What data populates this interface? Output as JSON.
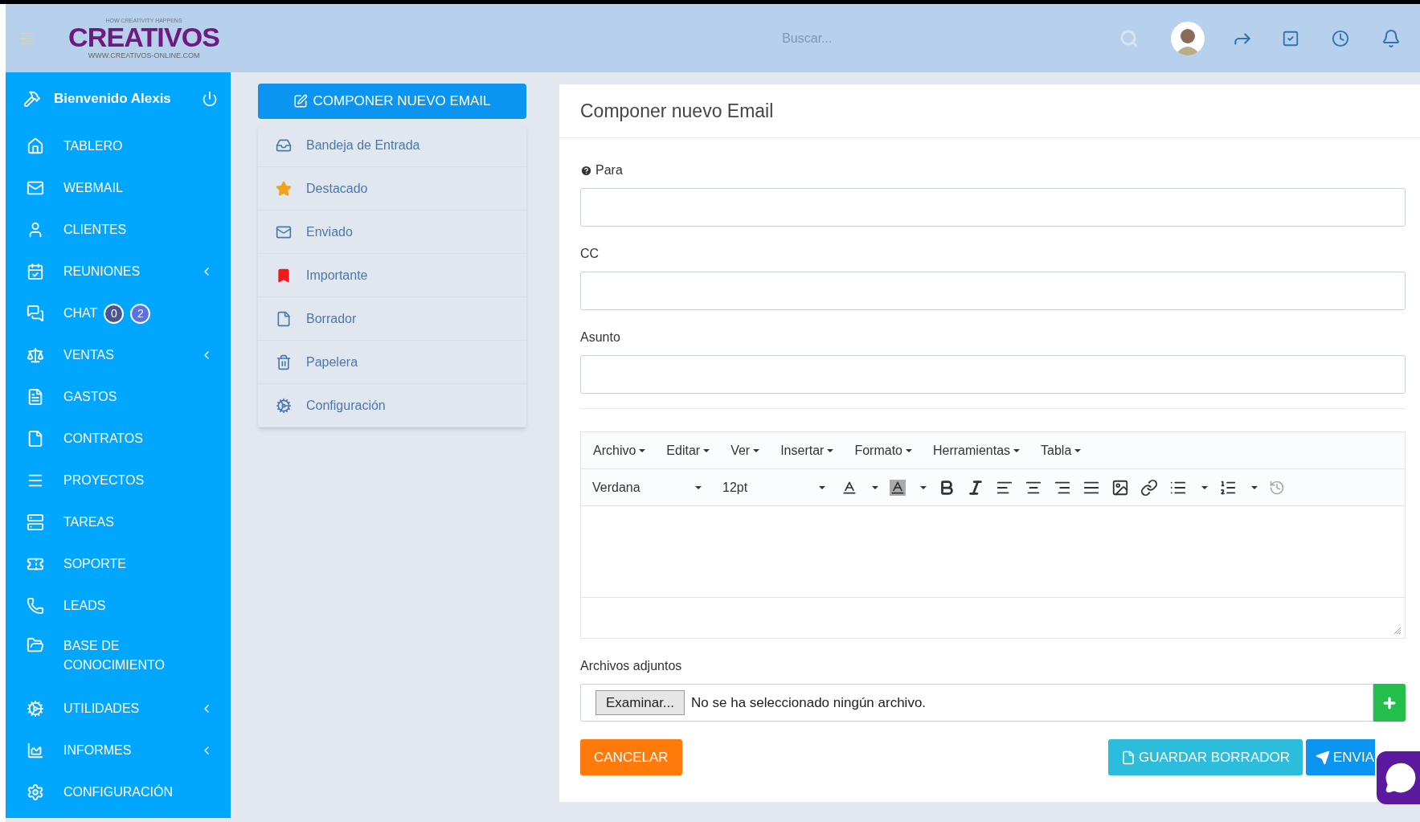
{
  "header": {
    "logo": {
      "tagline": "HOW CREATIVITY HAPPENS",
      "name": "CREATIVOS",
      "url": "WWW.CREATIVOS-ONLINE.COM"
    },
    "search": {
      "placeholder": "Buscar..."
    }
  },
  "sidebar": {
    "welcome": "Bienvenido Alexis",
    "items": [
      {
        "label": "TABLERO",
        "has_submenu": false
      },
      {
        "label": "WEBMAIL",
        "has_submenu": false
      },
      {
        "label": "CLIENTES",
        "has_submenu": false
      },
      {
        "label": "REUNIONES",
        "has_submenu": true
      },
      {
        "label": "CHAT",
        "has_submenu": false,
        "badges": [
          {
            "text": "0",
            "color": "#4a5494"
          },
          {
            "text": "2",
            "color": "#5b6fe8"
          }
        ]
      },
      {
        "label": "VENTAS",
        "has_submenu": true
      },
      {
        "label": "GASTOS",
        "has_submenu": false
      },
      {
        "label": "CONTRATOS",
        "has_submenu": false
      },
      {
        "label": "PROYECTOS",
        "has_submenu": false
      },
      {
        "label": "TAREAS",
        "has_submenu": false
      },
      {
        "label": "SOPORTE",
        "has_submenu": false
      },
      {
        "label": "LEADS",
        "has_submenu": false
      },
      {
        "label": "BASE DE CONOCIMIENTO",
        "has_submenu": false
      },
      {
        "label": "UTILIDADES",
        "has_submenu": true
      },
      {
        "label": "INFORMES",
        "has_submenu": true
      },
      {
        "label": "CONFIGURACIÓN",
        "has_submenu": false
      }
    ]
  },
  "mailbox": {
    "compose_button": "COMPONER NUEVO EMAIL",
    "folders": [
      {
        "label": "Bandeja de Entrada",
        "color": "#4a78b0"
      },
      {
        "label": "Destacado",
        "color": "#f4a21b"
      },
      {
        "label": "Enviado",
        "color": "#4a78b0"
      },
      {
        "label": "Importante",
        "color": "#f21b1b"
      },
      {
        "label": "Borrador",
        "color": "#4a78b0"
      },
      {
        "label": "Papelera",
        "color": "#4a78b0"
      },
      {
        "label": "Configuración",
        "color": "#4a78b0"
      }
    ]
  },
  "compose": {
    "title": "Componer nuevo Email",
    "fields": [
      {
        "label": "Para",
        "help_icon": true
      },
      {
        "label": "CC",
        "help_icon": false
      },
      {
        "label": "Asunto",
        "help_icon": false
      }
    ],
    "editor": {
      "menus": [
        "Archivo",
        "Editar",
        "Ver",
        "Insertar",
        "Formato",
        "Herramientas",
        "Tabla"
      ],
      "font": "Verdana",
      "size": "12pt"
    },
    "attachments": {
      "label": "Archivos adjuntos",
      "browse_button": "Examinar...",
      "file_status": "No se ha seleccionado ningún archivo."
    },
    "buttons": {
      "cancel": "CANCELAR",
      "save_draft": "GUARDAR BORRADOR",
      "send": "ENVIA"
    }
  }
}
